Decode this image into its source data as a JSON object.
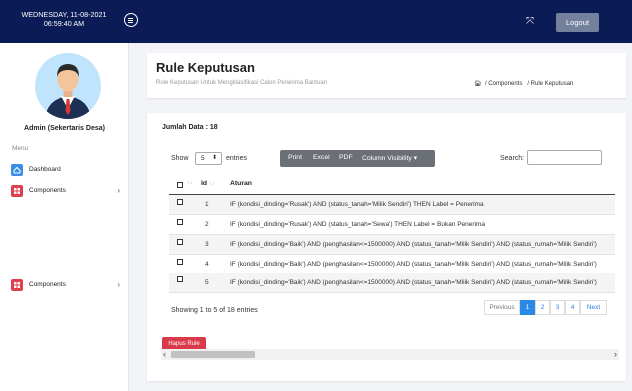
{
  "topbar": {
    "date": "WEDNESDAY, 11-08-2021",
    "time": "06:59:40 AM",
    "logout_label": "Logout"
  },
  "sidebar": {
    "user_name": "Admin (Sekertaris Desa)",
    "menu_label": "Menu",
    "items": [
      {
        "label": "Dashboard",
        "icon": "home-icon"
      },
      {
        "label": "Components",
        "icon": "grid-icon"
      },
      {
        "label": "Components",
        "icon": "grid-icon"
      }
    ]
  },
  "header": {
    "title": "Rule Keputusan",
    "subtitle": "Rule Keputusan Untuk Mengklasifikasi Calon Penerima Bantuan",
    "breadcrumb": [
      "Components",
      "Rule Keputusan"
    ]
  },
  "table_controls": {
    "total_label": "Jumlah Data : 18",
    "show_label": "Show",
    "show_value": "5",
    "entries_label": "entries",
    "buttons": [
      "Print",
      "Excel",
      "PDF",
      "Column Visibility"
    ],
    "search_label": "Search:",
    "search_value": ""
  },
  "table": {
    "columns": [
      "Id",
      "Aturan"
    ],
    "rows": [
      {
        "id": "1",
        "rule": "IF (kondisi_dinding='Rusak') AND (status_tanah='Milik Sendiri') THEN Label = Penerima"
      },
      {
        "id": "2",
        "rule": "IF (kondisi_dinding='Rusak') AND (status_tanah='Sewa') THEN Label = Bukan Penerima"
      },
      {
        "id": "3",
        "rule": "IF (kondisi_dinding='Baik') AND (penghasilan<=1500000) AND (status_tanah='Milik Sendiri') AND (status_rumah='Milik Sendiri')"
      },
      {
        "id": "4",
        "rule": "IF (kondisi_dinding='Baik') AND (penghasilan<=1500000) AND (status_tanah='Milik Sendiri') AND (status_rumah='Milik Sendiri')"
      },
      {
        "id": "5",
        "rule": "IF (kondisi_dinding='Baik') AND (penghasilan<=1500000) AND (status_tanah='Milik Sendiri') AND (status_rumah='Milik Sendiri')"
      }
    ]
  },
  "footer": {
    "info": "Showing 1 to 5 of 18 entries",
    "pagination": [
      "Previous",
      "1",
      "2",
      "3",
      "4",
      "Next"
    ],
    "active_page": "1",
    "delete_label": "Hapus Rule"
  },
  "colors": {
    "topbar": "#0b1b56",
    "primary": "#2b89e6",
    "danger": "#d93a4a"
  }
}
